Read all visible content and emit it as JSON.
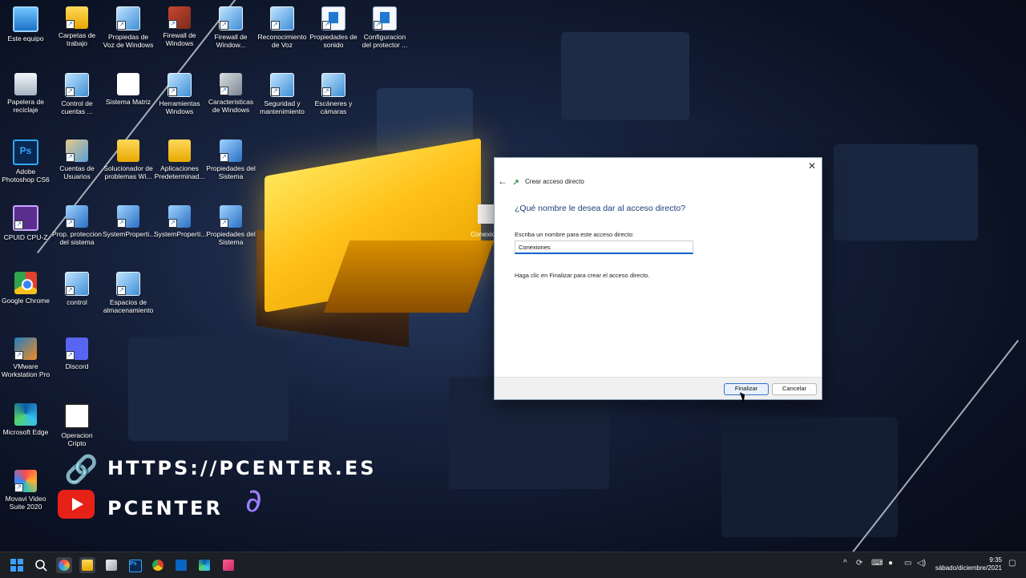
{
  "desktop": {
    "icons": [
      {
        "label": "Este equipo",
        "icon": "monitor-icon"
      },
      {
        "label": "Carpetas de trabajo",
        "icon": "folder-icon"
      },
      {
        "label": "Propiedas de Voz de Windows",
        "icon": "control-panel-icon"
      },
      {
        "label": "Firewall de Windows",
        "icon": "firewall-icon"
      },
      {
        "label": "Firewall de Window...",
        "icon": "control-panel-icon"
      },
      {
        "label": "Reconocimiento de Voz",
        "icon": "control-panel-icon"
      },
      {
        "label": "Propiedades de sonido",
        "icon": "document-icon"
      },
      {
        "label": "Configuracion del protector ...",
        "icon": "document-icon"
      },
      {
        "label": "Papelera de reciclaje",
        "icon": "recycle-bin-icon"
      },
      {
        "label": "Control de cuentas ...",
        "icon": "control-panel-icon"
      },
      {
        "label": "Sistema Matriz",
        "icon": "matrix-icon"
      },
      {
        "label": "Herramientas Windows",
        "icon": "control-panel-icon"
      },
      {
        "label": "Caracteristicas de Windows",
        "icon": "gear-icon"
      },
      {
        "label": "Seguridad y mantenimiento",
        "icon": "control-panel-icon"
      },
      {
        "label": "Escáneres y cámaras",
        "icon": "control-panel-icon"
      },
      {
        "label": "Adobe Photoshop CS6",
        "icon": "photoshop-icon"
      },
      {
        "label": "Cuentas de Usuarios",
        "icon": "users-icon"
      },
      {
        "label": "Solucionador de problemas Wi...",
        "icon": "folder-icon"
      },
      {
        "label": "Aplicaciones Predeterminad...",
        "icon": "folder-icon"
      },
      {
        "label": "Propiedades del Sistema",
        "icon": "shield-icon"
      },
      {
        "label": "CPUID CPU-Z",
        "icon": "cpu-icon"
      },
      {
        "label": "Prop. proteccion del sistema",
        "icon": "shield-icon"
      },
      {
        "label": "SystemProperti...",
        "icon": "shield-icon"
      },
      {
        "label": "SystemProperti...",
        "icon": "shield-icon"
      },
      {
        "label": "Propiedades del Sistema",
        "icon": "shield-icon"
      },
      {
        "label": "Google Chrome",
        "icon": "chrome-icon"
      },
      {
        "label": "control",
        "icon": "control-panel-icon"
      },
      {
        "label": "Espacios de almacenamiento",
        "icon": "control-panel-icon"
      },
      {
        "label": "VMware Workstation Pro",
        "icon": "vmware-icon"
      },
      {
        "label": "Discord",
        "icon": "discord-icon"
      },
      {
        "label": "Microsoft Edge",
        "icon": "edge-icon"
      },
      {
        "label": "Operacion Cripto",
        "icon": "film-icon"
      },
      {
        "label": "Movavi Video Suite 2020",
        "icon": "movavi-icon"
      }
    ],
    "partial_icon_label": "Conexio"
  },
  "brand": {
    "url": "HTTPS://PCENTER.ES",
    "name": "PCENTER"
  },
  "dialog": {
    "window_title": "Crear acceso directo",
    "heading": "¿Qué nombre le desea dar al acceso directo?",
    "field_label": "Escriba un nombre para este acceso directo:",
    "field_value": "Conexiones",
    "hint": "Haga clic en Finalizar para crear el acceso directo.",
    "finish_label": "Finalizar",
    "cancel_label": "Cancelar",
    "accent": "#0a63c9"
  },
  "taskbar": {
    "apps": [
      "start-icon",
      "search-icon",
      "movavi-icon",
      "file-explorer-icon",
      "store-icon",
      "photoshop-icon",
      "chrome-icon",
      "outlook-icon",
      "edge-icon",
      "snip-icon"
    ],
    "clock_time": "9:35",
    "clock_date": "sábado/diciembre/2021"
  }
}
